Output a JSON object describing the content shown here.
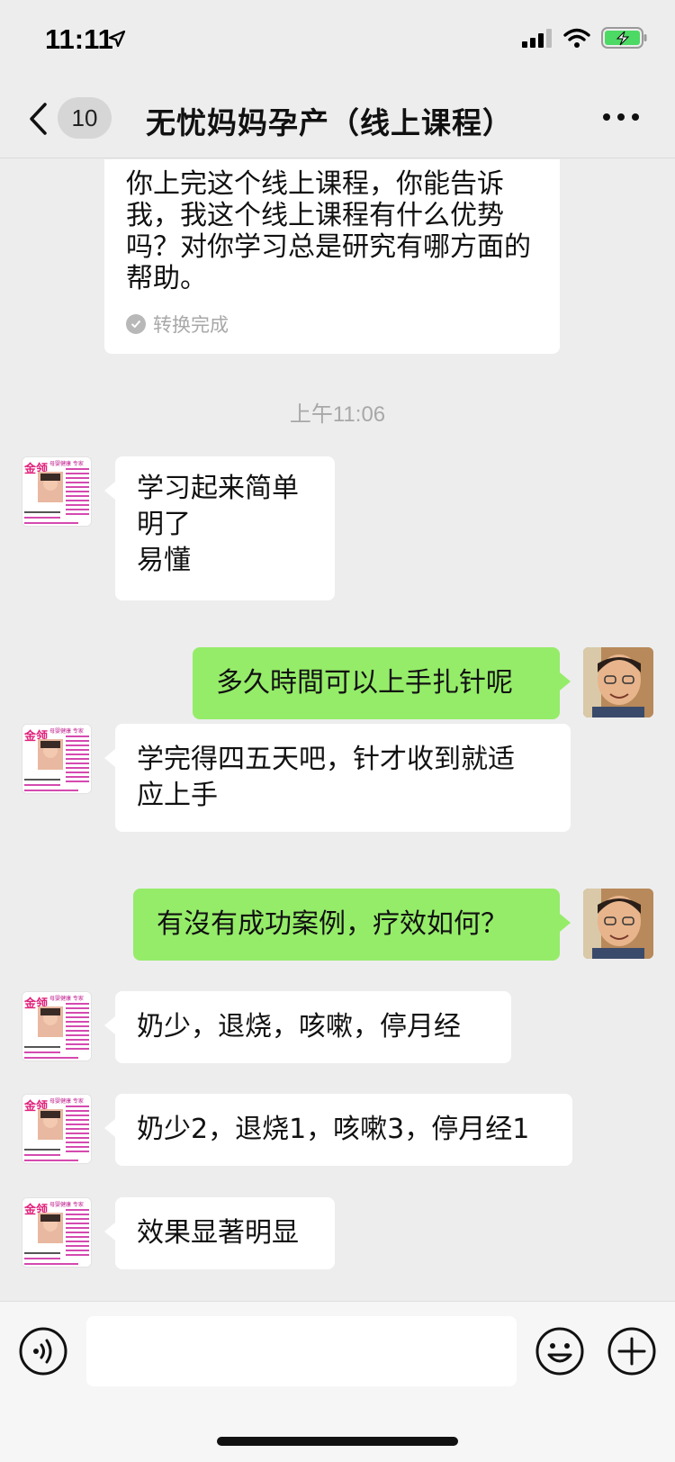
{
  "status_bar": {
    "time": "11:11"
  },
  "nav": {
    "unread_count": "10",
    "title": "无忧妈妈孕产（线上课程）"
  },
  "transcript": {
    "text": "你上完这个线上课程，你能告诉我，我这个线上课程有什么优势吗？对你学习总是研究有哪方面的帮助。",
    "status": "转换完成"
  },
  "timestamp": "上午11:06",
  "messages": [
    {
      "side": "left",
      "text": "学习起来简单\n明了\n易懂"
    },
    {
      "side": "right",
      "text": "多久時間可以上手扎针呢"
    },
    {
      "side": "left",
      "text": "学完得四五天吧，针才收到就适\n应上手"
    },
    {
      "side": "right",
      "text": "有沒有成功案例，疗效如何？"
    },
    {
      "side": "left",
      "text": "奶少，退烧，咳嗽，停月经"
    },
    {
      "side": "left",
      "text": "奶少2，退烧1，咳嗽3，停月经1"
    },
    {
      "side": "left",
      "text": "效果显著明显"
    }
  ],
  "avatar_left": {
    "brand_text": "金领",
    "header_text": "母婴健康 专家"
  },
  "input": {
    "placeholder": ""
  },
  "colors": {
    "background": "#ededed",
    "sent_bubble": "#95ec69",
    "received_bubble": "#ffffff",
    "muted_text": "#a8a8a8"
  }
}
